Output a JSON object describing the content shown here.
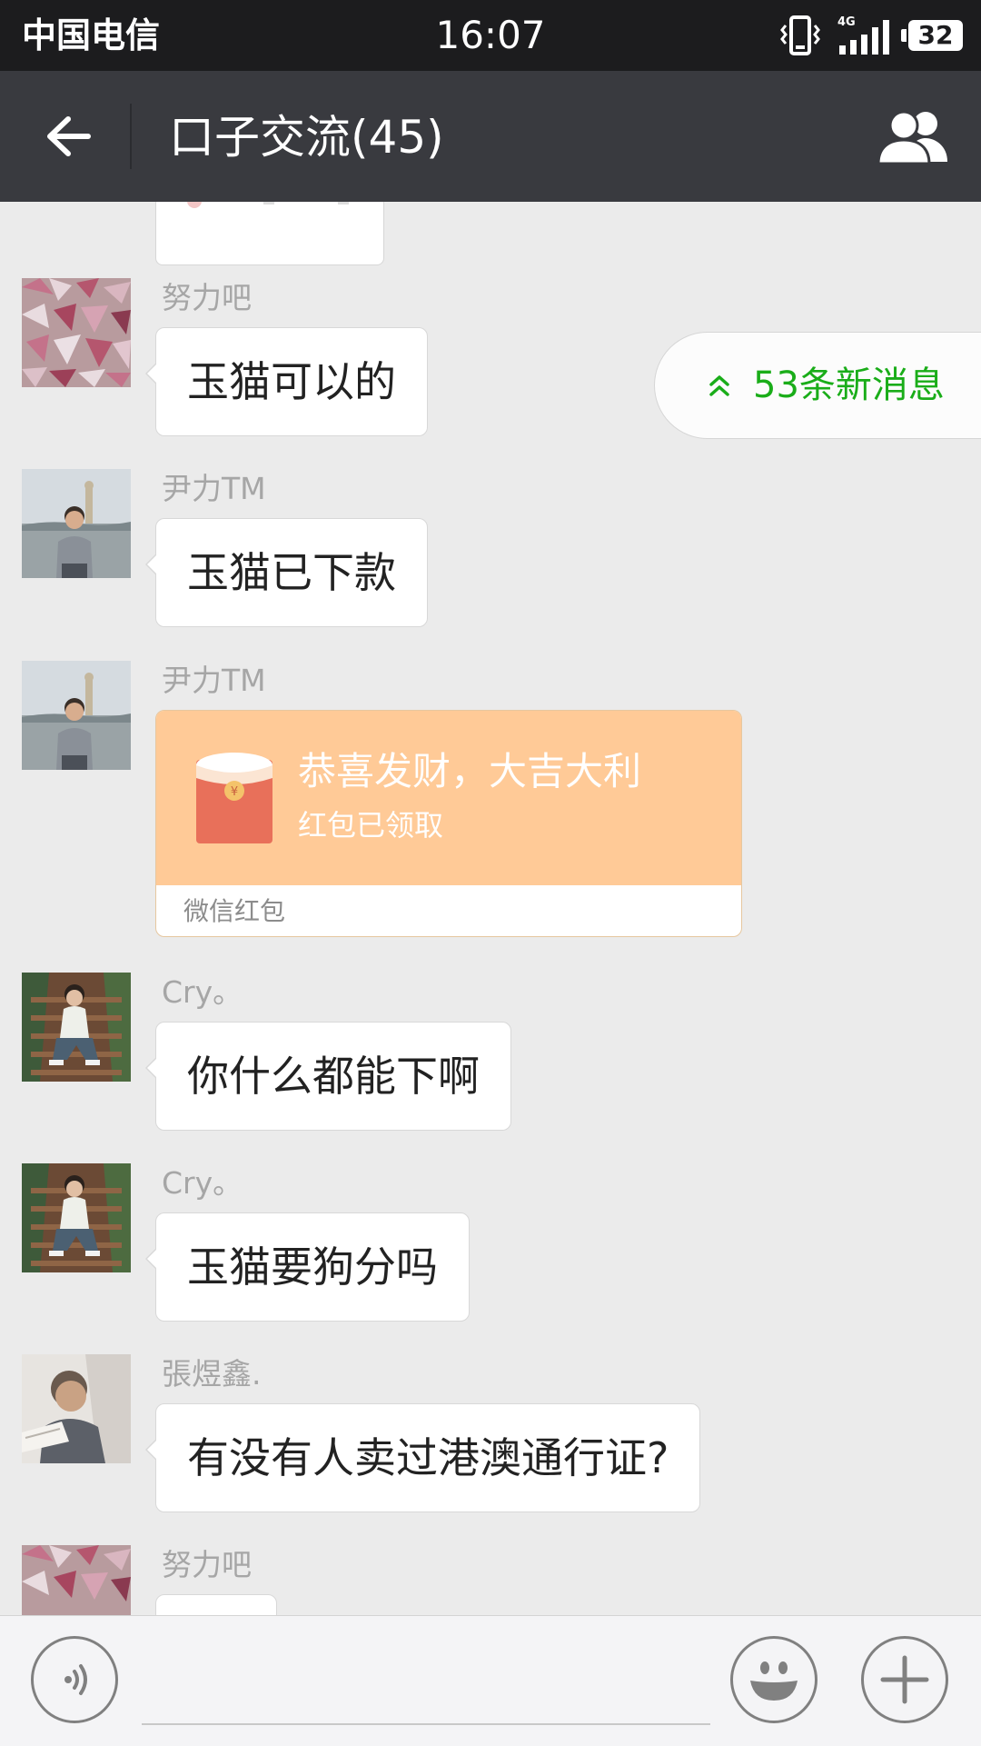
{
  "status_bar": {
    "carrier": "中国电信",
    "time": "16:07",
    "network": "4G",
    "battery": "32"
  },
  "header": {
    "title": "口子交流(45)",
    "back_icon": "arrow-left-icon",
    "members_icon": "group-members-icon"
  },
  "new_messages": {
    "label": "53条新消息",
    "icon": "double-chevron-up-icon",
    "color": "#1aad19"
  },
  "messages": [
    {
      "sender": "努力吧",
      "text": "玉猫可以的",
      "avatar": "pink-candies-avatar"
    },
    {
      "sender": "尹力TM",
      "text": "玉猫已下款",
      "avatar": "man-by-sea-avatar"
    },
    {
      "sender": "尹力TM",
      "type": "red_packet",
      "avatar": "man-by-sea-avatar",
      "red_packet": {
        "title": "恭喜发财，大吉大利",
        "status": "红包已领取",
        "footer": "微信红包"
      }
    },
    {
      "sender": "Cry。",
      "text": "你什么都能下啊",
      "avatar": "young-man-stairs-avatar"
    },
    {
      "sender": "Cry。",
      "text": "玉猫要狗分吗",
      "avatar": "young-man-stairs-avatar"
    },
    {
      "sender": "張煜鑫.",
      "text": "有没有人卖过港澳通行证?",
      "avatar": "man-reading-avatar"
    },
    {
      "sender": "努力吧",
      "text": "",
      "avatar": "pink-candies-avatar"
    }
  ],
  "input_bar": {
    "voice_icon": "voice-input-icon",
    "emoji_icon": "emoji-smile-icon",
    "plus_icon": "plus-icon",
    "value": ""
  },
  "colors": {
    "title_bar": "#393a3f",
    "status_bar": "#1c1c1e",
    "chat_background": "#ebebeb",
    "red_packet": "#ffca97",
    "accent_green": "#1aad19"
  }
}
